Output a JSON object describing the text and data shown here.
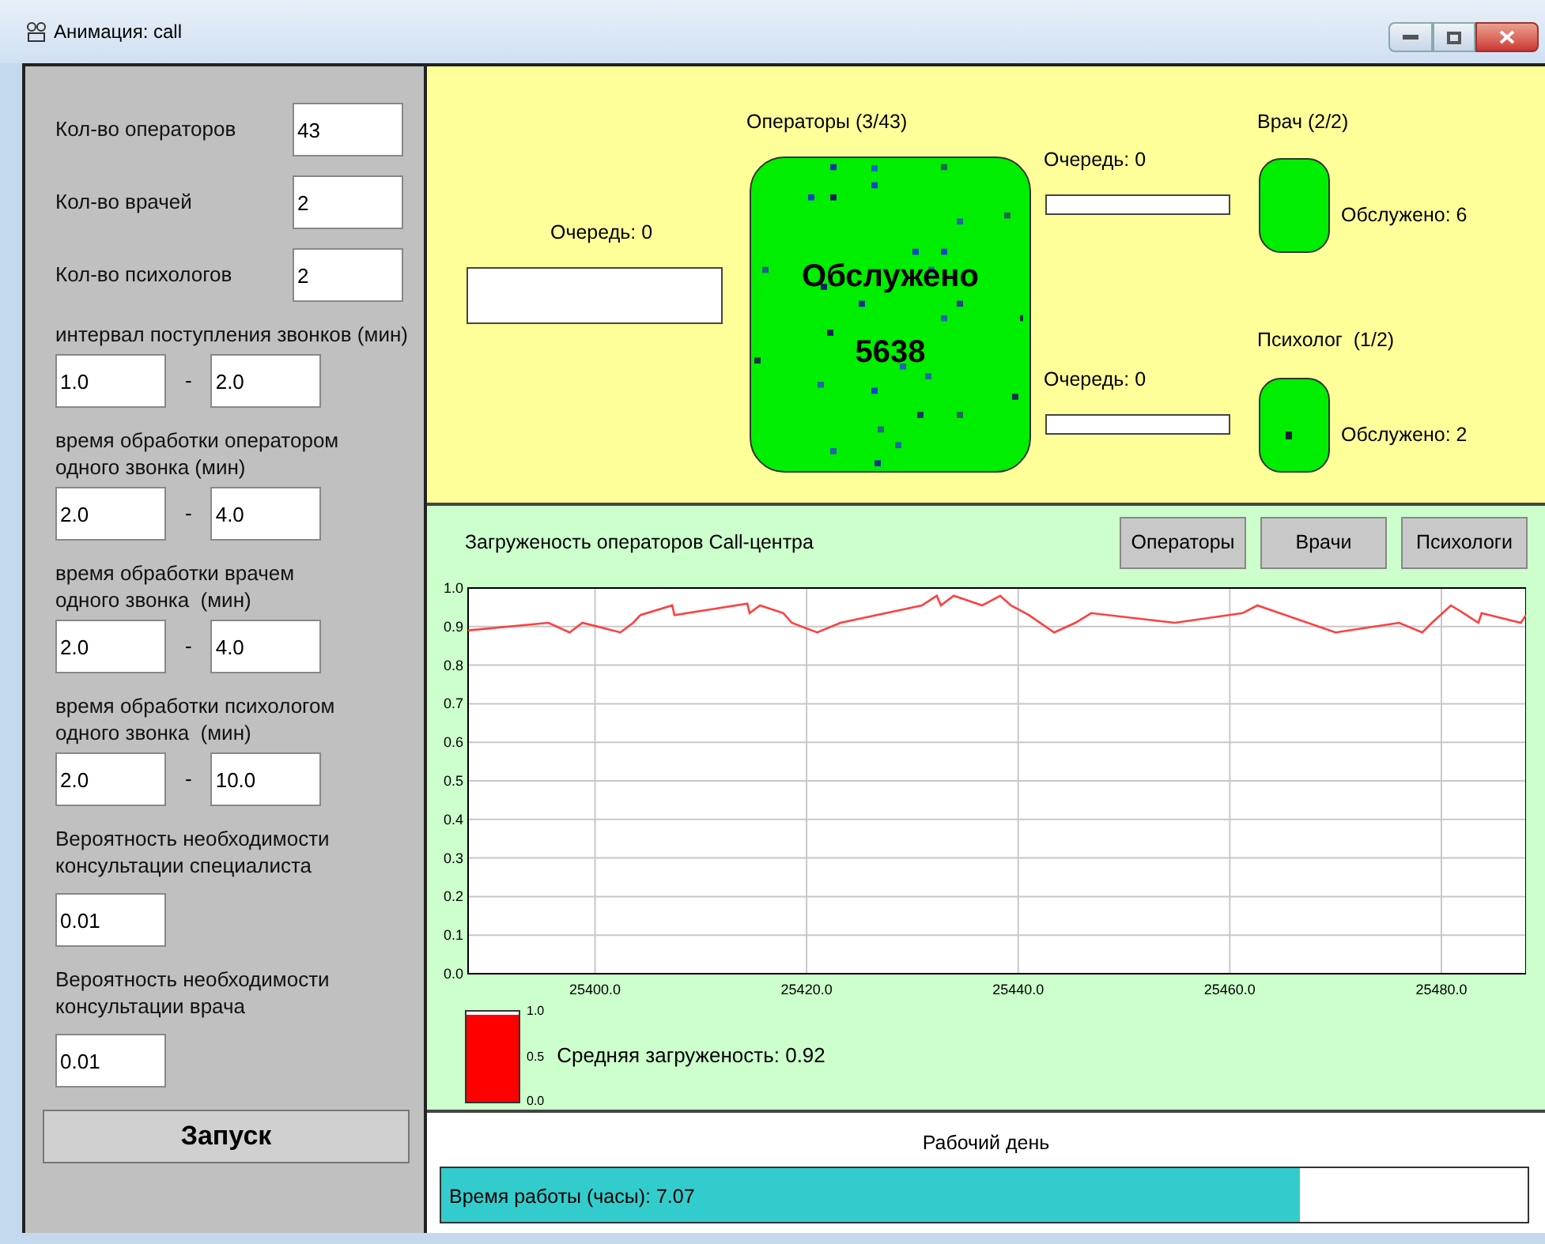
{
  "window": {
    "title": "Анимация: call"
  },
  "params": [
    {
      "kind": "inline",
      "label": "Кол-во операторов",
      "value": "43"
    },
    {
      "kind": "inline",
      "label": "Кол-во врачей",
      "value": "2"
    },
    {
      "kind": "inline",
      "label": "Кол-во психологов",
      "value": "2"
    },
    {
      "kind": "range",
      "label": "интервал поступления звонков (мин)",
      "from": "1.0",
      "separator": "-",
      "to": "2.0"
    },
    {
      "kind": "range",
      "label": "время обработки оператором\nодного звонка (мин)",
      "from": "2.0",
      "separator": "-",
      "to": "4.0"
    },
    {
      "kind": "range",
      "label": "время обработки врачем\nодного звонка  (мин)",
      "from": "2.0",
      "separator": "-",
      "to": "4.0"
    },
    {
      "kind": "range",
      "label": "время обработки психологом\nодного звонка  (мин)",
      "from": "2.0",
      "separator": "-",
      "to": "10.0"
    },
    {
      "kind": "stacked",
      "label": "Вероятность необходимости\nконсультации специалиста",
      "value": "0.01"
    },
    {
      "kind": "stacked",
      "label": "Вероятность необходимости\nконсультации врача",
      "value": "0.01"
    }
  ],
  "start_button": "Запуск",
  "flow": {
    "main_queue": "Очередь: 0",
    "operators": {
      "title": "Операторы (3/43)",
      "served_label": "Обслужено",
      "served_count": "5638"
    },
    "doctor_queue": "Очередь: 0",
    "psych_queue": "Очередь: 0",
    "doctor": {
      "title": "Врач (2/2)",
      "served": "Обслужено: 6"
    },
    "psychologist": {
      "title": "Психолог  (1/2)",
      "served": "Обслужено: 2"
    }
  },
  "load_panel": {
    "title": "Загруженость операторов Call-центра",
    "buttons": [
      "Операторы",
      "Врачи",
      "Психологи"
    ],
    "chart_data": {
      "type": "line",
      "grid": true,
      "xlim": [
        25388,
        25488
      ],
      "ylim": [
        0,
        1
      ],
      "xticks": [
        {
          "value": 25400,
          "label": "25400.0"
        },
        {
          "value": 25420,
          "label": "25420.0"
        },
        {
          "value": 25440,
          "label": "25440.0"
        },
        {
          "value": 25460,
          "label": "25460.0"
        },
        {
          "value": 25480,
          "label": "25480.0"
        }
      ],
      "yticks": [
        {
          "value": 0,
          "label": "0.0"
        },
        {
          "value": 0.1,
          "label": "0.1"
        },
        {
          "value": 0.2,
          "label": "0.2"
        },
        {
          "value": 0.3,
          "label": "0.3"
        },
        {
          "value": 0.4,
          "label": "0.4"
        },
        {
          "value": 0.5,
          "label": "0.5"
        },
        {
          "value": 0.6,
          "label": "0.6"
        },
        {
          "value": 0.7,
          "label": "0.7"
        },
        {
          "value": 0.8,
          "label": "0.8"
        },
        {
          "value": 0.9,
          "label": "0.9"
        },
        {
          "value": 1,
          "label": "1.0"
        }
      ],
      "x": [
        25388,
        25395.6,
        25397.6,
        25398.8,
        25402.4,
        25403.6,
        25404.3,
        25407.3,
        25407.5,
        25414.4,
        25414.6,
        25415.6,
        25417.8,
        25418.6,
        25421,
        25423.2,
        25430.9,
        25432.3,
        25432.7,
        25433.9,
        25436.6,
        25438.3,
        25439.3,
        25441,
        25443.4,
        25445.4,
        25446.9,
        25454.8,
        25461.2,
        25462.6,
        25470,
        25476,
        25478.2,
        25479.1,
        25480.9,
        25482.1,
        25483.5,
        25483.8,
        25487.5,
        25488
      ],
      "series": [
        {
          "color": "#ff4040",
          "values": [
            0.89,
            0.91,
            0.885,
            0.91,
            0.885,
            0.91,
            0.93,
            0.955,
            0.93,
            0.96,
            0.935,
            0.955,
            0.935,
            0.91,
            0.885,
            0.91,
            0.955,
            0.98,
            0.955,
            0.98,
            0.955,
            0.98,
            0.955,
            0.93,
            0.885,
            0.91,
            0.935,
            0.91,
            0.935,
            0.955,
            0.885,
            0.91,
            0.885,
            0.91,
            0.955,
            0.935,
            0.91,
            0.935,
            0.91,
            0.93
          ]
        }
      ]
    },
    "meter": {
      "level": 0.95,
      "ticks": [
        "1.0",
        "0.5",
        "0.0"
      ],
      "reading": "Средняя загруженость: 0.92"
    }
  },
  "workday": {
    "title": "Рабочий день",
    "progress": {
      "level": 0.79,
      "label": "Время работы (часы): 7.07"
    }
  }
}
